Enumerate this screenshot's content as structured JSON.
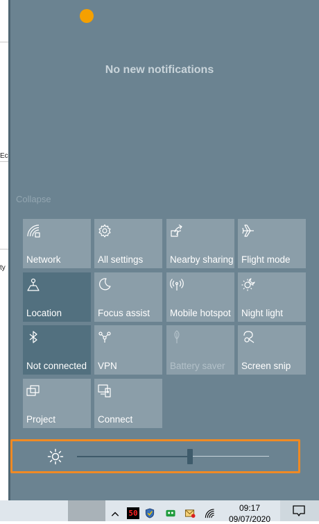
{
  "notifications": {
    "empty_message": "No new notifications"
  },
  "collapse_label": "Collapse",
  "tiles": [
    {
      "label": "Network",
      "icon": "network-icon",
      "on": false,
      "disabled": false
    },
    {
      "label": "All settings",
      "icon": "gear-icon",
      "on": false,
      "disabled": false
    },
    {
      "label": "Nearby sharing",
      "icon": "share-icon",
      "on": false,
      "disabled": false
    },
    {
      "label": "Flight mode",
      "icon": "airplane-icon",
      "on": false,
      "disabled": false
    },
    {
      "label": "Location",
      "icon": "location-icon",
      "on": true,
      "disabled": false
    },
    {
      "label": "Focus assist",
      "icon": "moon-icon",
      "on": false,
      "disabled": false
    },
    {
      "label": "Mobile hotspot",
      "icon": "hotspot-icon",
      "on": false,
      "disabled": false
    },
    {
      "label": "Night light",
      "icon": "sun-moon-icon",
      "on": false,
      "disabled": false
    },
    {
      "label": "Not connected",
      "icon": "bluetooth-icon",
      "on": true,
      "disabled": false
    },
    {
      "label": "VPN",
      "icon": "vpn-icon",
      "on": false,
      "disabled": false
    },
    {
      "label": "Battery saver",
      "icon": "leaf-icon",
      "on": false,
      "disabled": true
    },
    {
      "label": "Screen snip",
      "icon": "scissors-icon",
      "on": false,
      "disabled": false
    },
    {
      "label": "Project",
      "icon": "project-icon",
      "on": false,
      "disabled": false
    },
    {
      "label": "Connect",
      "icon": "connect-icon",
      "on": false,
      "disabled": false
    }
  ],
  "brightness": {
    "icon": "brightness-sun-icon",
    "level": 0.59,
    "highlight_color": "#f08a24"
  },
  "background_fragments": [
    "Ec",
    "ty"
  ],
  "taskbar": {
    "clock": "09:17",
    "date": "09/07/2020",
    "tray_badge": "50",
    "icons": [
      "app-orange-icon",
      "chevron-up-icon",
      "meter-icon",
      "shield-icon",
      "robot-icon",
      "mail-icon",
      "wifi-icon",
      "notification-icon"
    ]
  },
  "colors": {
    "panel": "#6b8391",
    "tile": "#8b9ea9",
    "tile_on": "#52707f"
  }
}
